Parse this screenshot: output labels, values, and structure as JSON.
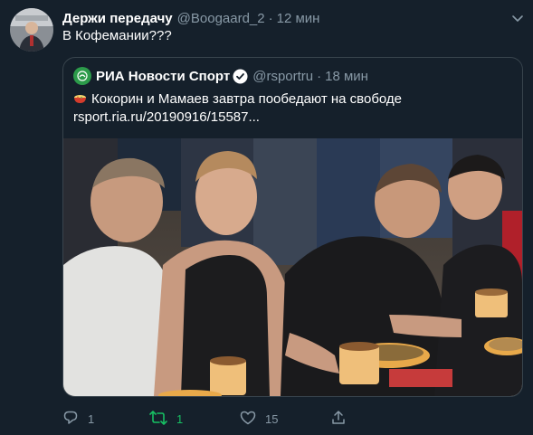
{
  "tweet": {
    "display_name": "Держи передачу",
    "handle": "@Boogaard_2",
    "separator": "·",
    "time": "12 мин",
    "text": "В Кофемании???"
  },
  "quote": {
    "display_name": "РИА Новости Спорт",
    "handle": "@rsportru",
    "separator": "·",
    "time": "18 мин",
    "text_line1": "Кокорин и Мамаев завтра пообедают на свободе",
    "text_line2": "rsport.ria.ru/20190916/15587..."
  },
  "actions": {
    "reply_count": "1",
    "retweet_count": "1",
    "like_count": "15"
  },
  "colors": {
    "background": "#15202b",
    "secondary_text": "#8899a6",
    "border": "#38444d",
    "retweet_active": "#17bf63",
    "verified": "#ffffff",
    "ria_logo": "#2c9b4a"
  },
  "icons": {
    "caret": "chevron-down-icon",
    "verified": "verified-badge-icon",
    "food": "pot-of-food-icon",
    "reply": "reply-icon",
    "retweet": "retweet-icon",
    "like": "heart-icon",
    "share": "share-icon"
  }
}
